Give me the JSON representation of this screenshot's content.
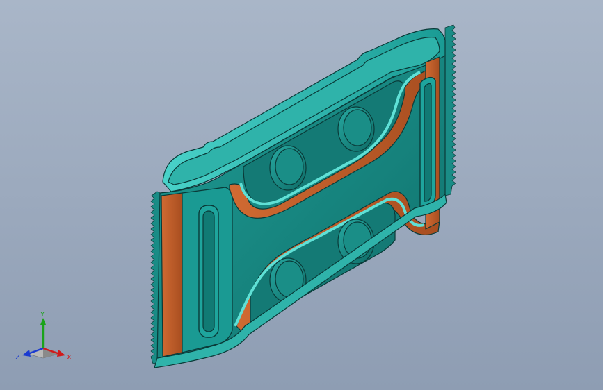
{
  "colors": {
    "background_top": "#a9b6c8",
    "background_bottom": "#8e9db3",
    "teal_face": "#178c86",
    "teal_light": "#35c2ba",
    "teal_edge": "#0a3a38",
    "copper": "#c4612c",
    "copper_dark": "#8f3f17",
    "axis_x": "#d11a1a",
    "axis_y": "#1aa31a",
    "axis_z": "#1a3ad1"
  },
  "view_triad": {
    "x_label": "X",
    "y_label": "Y",
    "z_label": "Z"
  }
}
